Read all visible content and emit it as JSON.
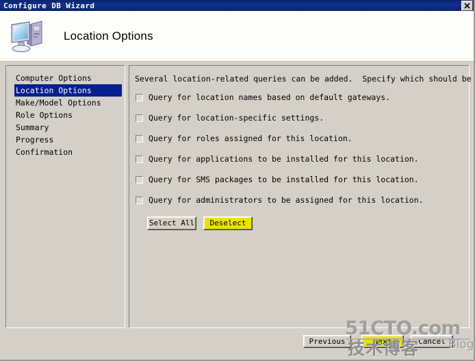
{
  "window": {
    "title": "Configure DB Wizard",
    "close_icon": "close-icon",
    "close_label": "X"
  },
  "header": {
    "icon": "computer-workstation-icon",
    "title": "Location Options"
  },
  "sidebar": {
    "items": [
      {
        "label": "Computer Options",
        "selected": false
      },
      {
        "label": "Location Options",
        "selected": true
      },
      {
        "label": "Make/Model Options",
        "selected": false
      },
      {
        "label": "Role Options",
        "selected": false
      },
      {
        "label": "Summary",
        "selected": false
      },
      {
        "label": "Progress",
        "selected": false
      },
      {
        "label": "Confirmation",
        "selected": false
      }
    ]
  },
  "main": {
    "intro": "Several location-related queries can be added.  Specify which should be configured.",
    "checkboxes": [
      {
        "label": "Query for location names based on default gateways.",
        "checked": false
      },
      {
        "label": "Query for location-specific settings.",
        "checked": false
      },
      {
        "label": "Query for roles assigned for this location.",
        "checked": false
      },
      {
        "label": "Query for applications to be installed for this location.",
        "checked": false
      },
      {
        "label": "Query for SMS packages to be installed for this location.",
        "checked": false
      },
      {
        "label": "Query for administrators to be assigned for this location.",
        "checked": false
      }
    ],
    "select_all_label": "Select All",
    "deselect_label": "Deselect"
  },
  "footer": {
    "previous_label": "Previous",
    "next_label": "Next",
    "cancel_label": "Cancel"
  },
  "watermark": {
    "top": "51CTO.com",
    "cjk": "技术博客",
    "blog": "Blog"
  },
  "colors": {
    "titlebar": "#0a246a",
    "window_face": "#d4d0c8",
    "header_bg": "#fdfdfa",
    "selection": "#0a1f8f",
    "highlight_yellow": "#e9e400"
  }
}
